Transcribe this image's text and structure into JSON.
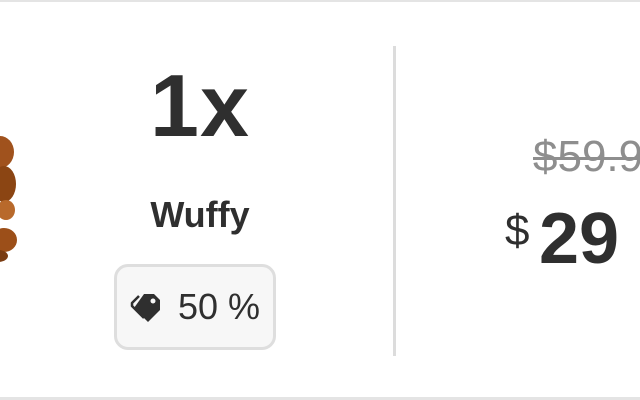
{
  "item": {
    "quantity": "1x",
    "name": "Wuffy",
    "discount": "50 %",
    "old_price": "$59.9",
    "currency": "$",
    "new_price": "29"
  },
  "icons": {
    "discount": "tags-icon",
    "product": "plush-dog-image"
  }
}
